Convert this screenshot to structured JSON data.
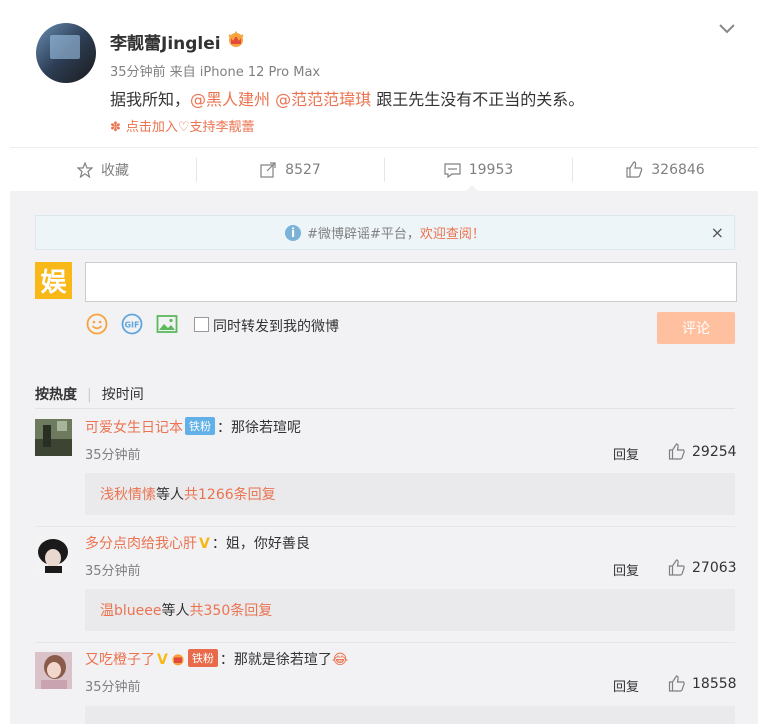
{
  "post": {
    "author": "李靓蕾Jinglei",
    "meta": "35分钟前 来自 iPhone 12 Pro Max",
    "text_prefix": "据我所知，",
    "mention1": "@黑人建州",
    "mention2": "@范范范瑋琪",
    "text_suffix": " 跟王先生没有不正当的关系。",
    "join": "点击加入♡支持李靓蕾"
  },
  "actions": {
    "favorite": "收藏",
    "repost": "8527",
    "comment": "19953",
    "like": "326846"
  },
  "notice": {
    "prefix": "#微博辟谣#平台，",
    "highlight": "欢迎查阅！",
    "close": "×"
  },
  "composer": {
    "my_avatar_char": "娱",
    "input_value": "",
    "repost_check_label": "同时转发到我的微博",
    "submit": "评论"
  },
  "sort": {
    "hot": "按热度",
    "time": "按时间"
  },
  "comments": [
    {
      "name": "可爱女生日记本",
      "badge": "铁粉",
      "text": "：那徐若瑄呢",
      "time": "35分钟前",
      "reply": "回复",
      "likes": "29254",
      "sub_user": "浅秋情愫",
      "sub_mid": " 等人 ",
      "sub_count": "共1266条回复"
    },
    {
      "name": "多分点肉给我心肝",
      "vflag": "V",
      "text": "：姐，你好善良",
      "time": "35分钟前",
      "reply": "回复",
      "likes": "27063",
      "sub_user": "温blueee",
      "sub_mid": " 等人 ",
      "sub_count": "共350条回复"
    },
    {
      "name": "又吃橙子了",
      "vflag": "V",
      "badge": "铁粉",
      "text": "：那就是徐若瑄了",
      "emoji": "😂",
      "time": "35分钟前",
      "reply": "回复",
      "likes": "18558"
    }
  ],
  "colors": {
    "accent": "#eb7350",
    "submit_bg": "#ffc09f",
    "comment_bg": "#f2f2f5"
  }
}
